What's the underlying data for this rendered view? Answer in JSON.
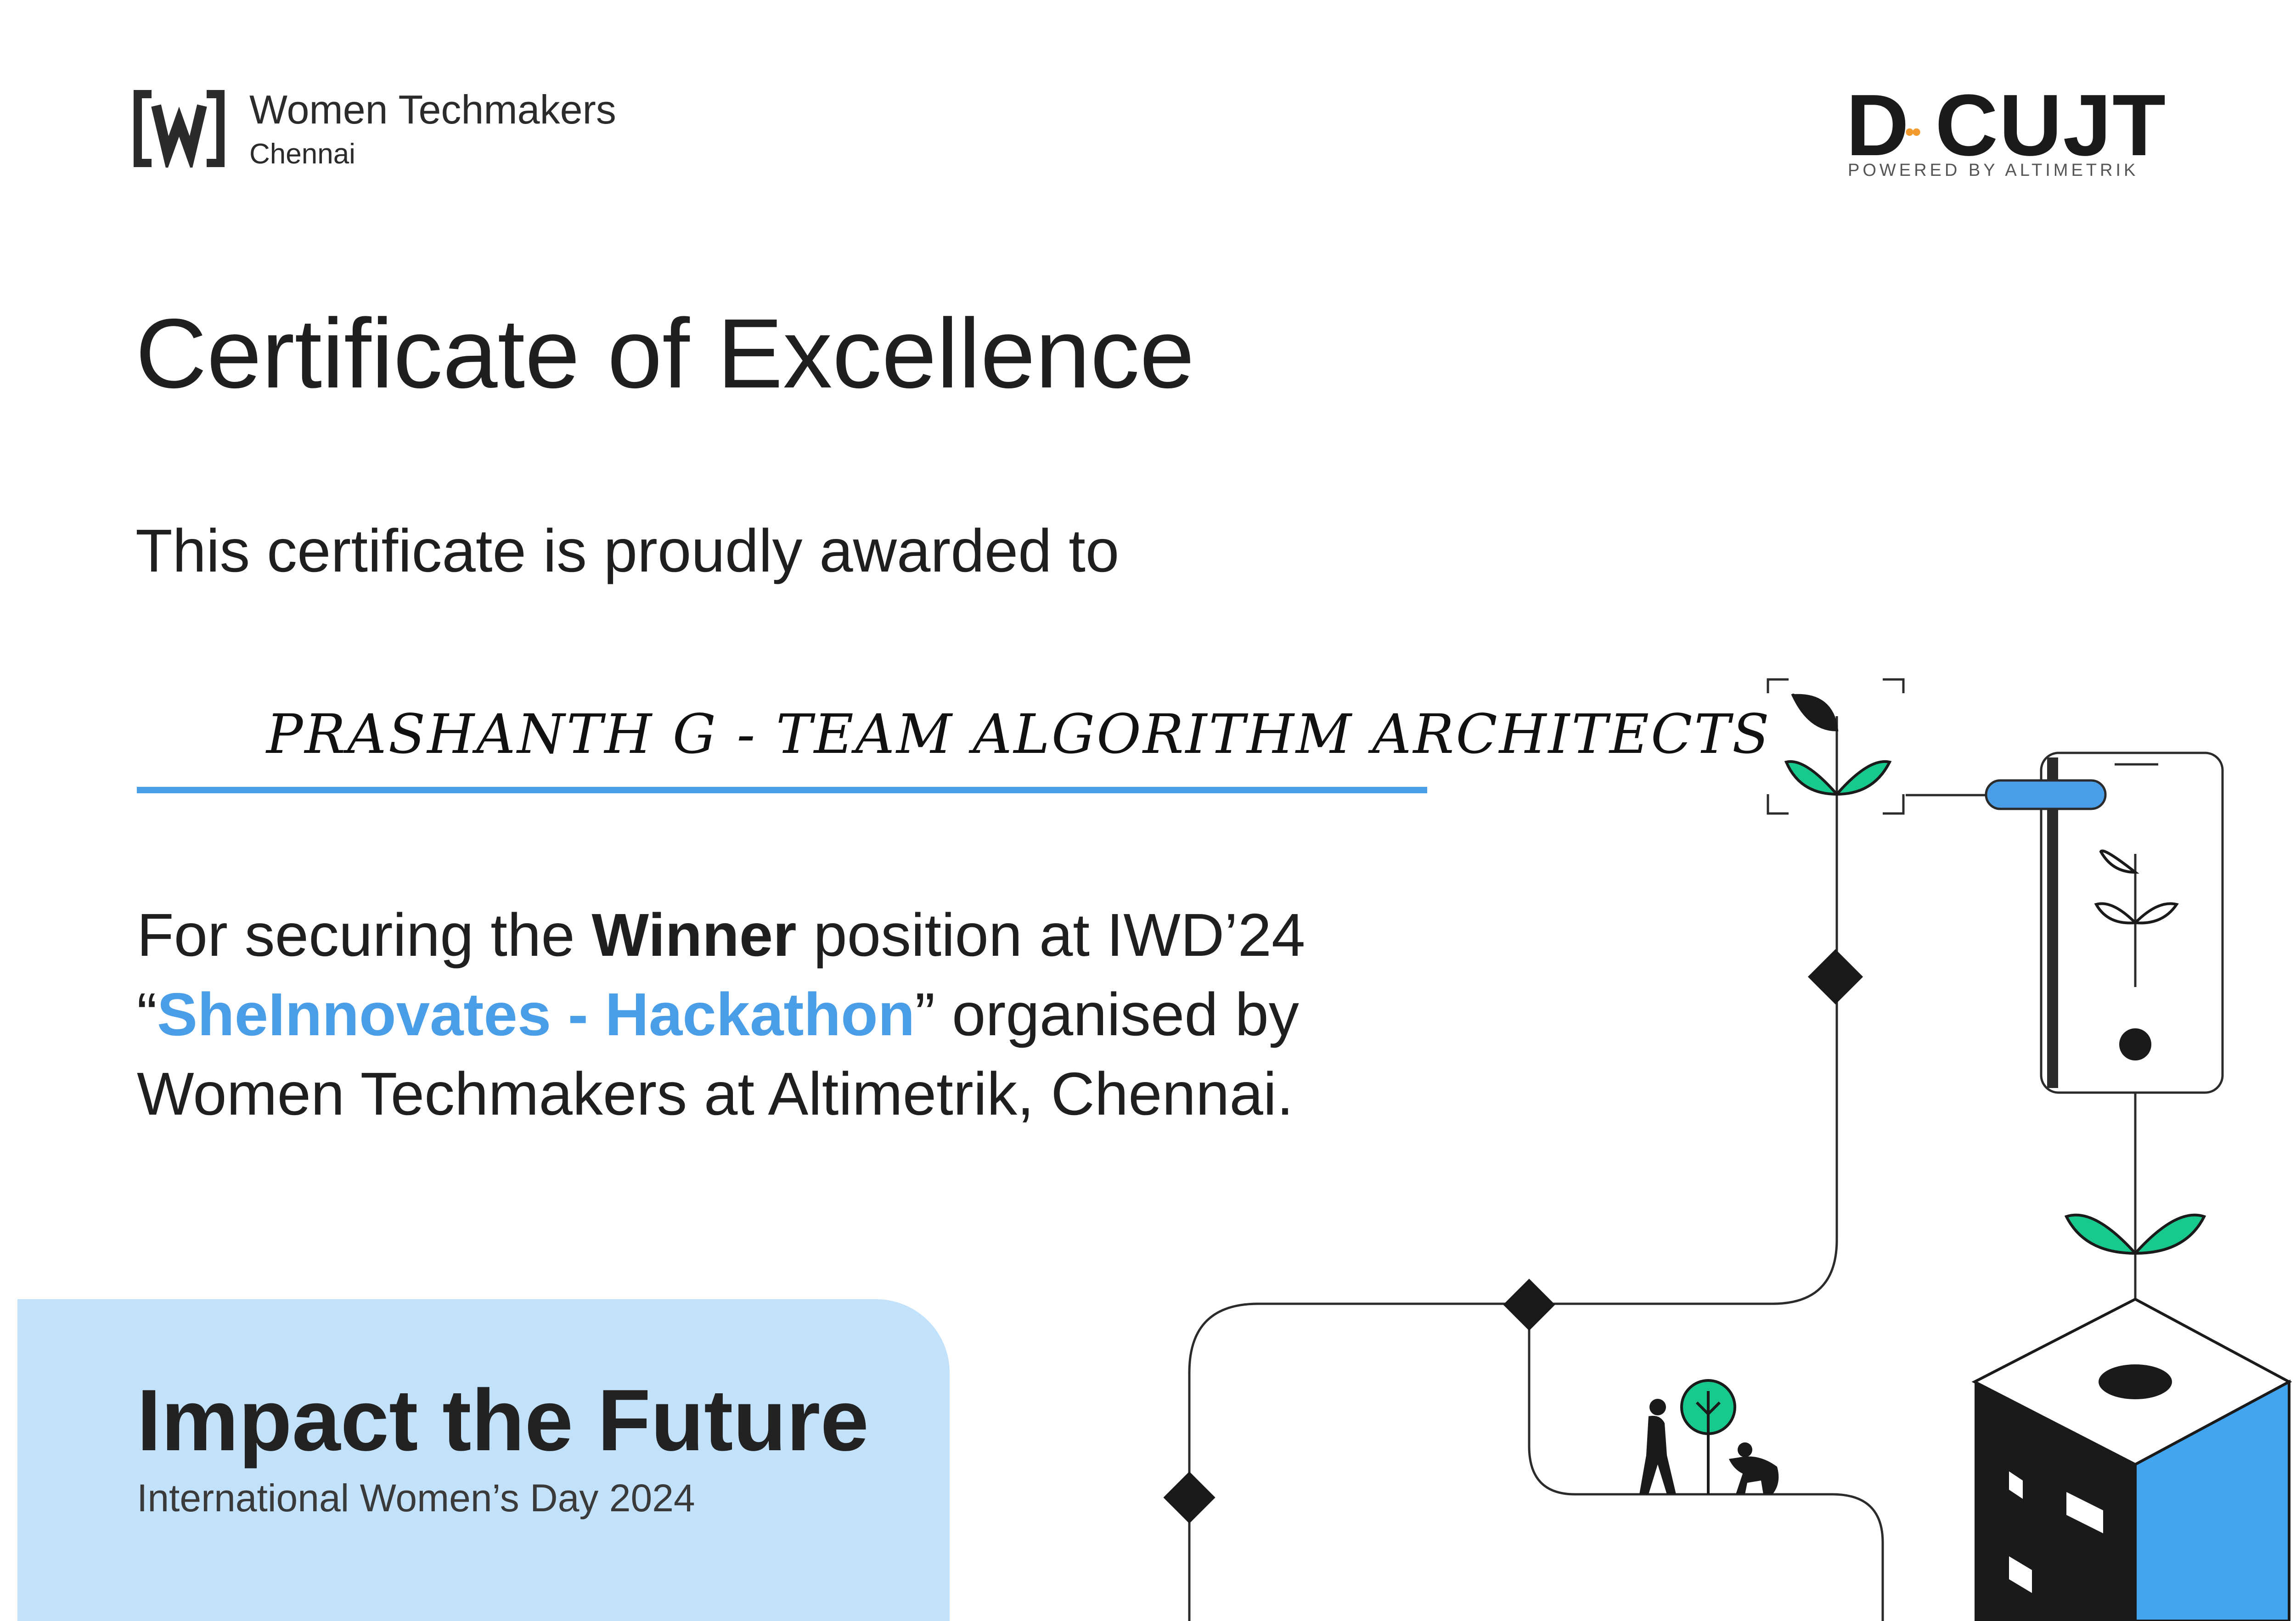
{
  "header": {
    "wtm_logo_icon": "women-techmakers-w-logo",
    "wtm_name": "Women Techmakers",
    "wtm_city": "Chennai",
    "dcult_word": "D CUJT",
    "dcult_dots": "••",
    "dcult_sub": "POWERED BY ALTIMETRIK"
  },
  "certificate": {
    "title": "Certificate of Excellence",
    "intro": "This certificate is proudly awarded to",
    "recipient": "PRASHANTH G - TEAM ALGORITHM ARCHITECTS",
    "line1_prefix": "For securing the ",
    "line1_bold": "Winner",
    "line1_suffix": " position at IWD’24",
    "line2_open_quote": "“",
    "line2_highlight": "SheInnovates - Hackathon",
    "line2_suffix": "”  organised by",
    "line3": "Women Techmakers at Altimetrik, Chennai."
  },
  "footer": {
    "impact_title": "Impact the Future",
    "impact_sub": "International Women’s Day 2024"
  },
  "colors": {
    "accent_blue": "#4a9ee8",
    "panel_blue": "#c2e2fb",
    "leaf_green": "#17c98a",
    "dcult_orange": "#f29a2e"
  }
}
